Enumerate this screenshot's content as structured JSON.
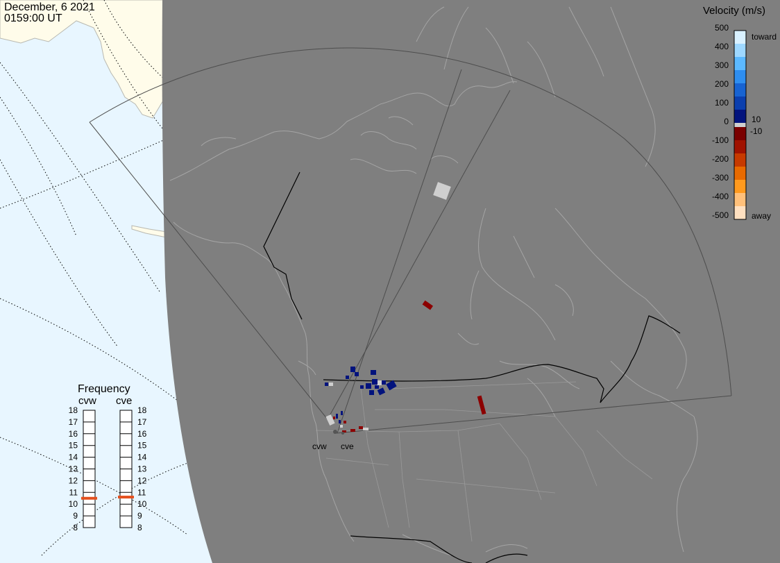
{
  "header": {
    "date": "December, 6 2021",
    "time": "0159:00 UT"
  },
  "colorbar": {
    "title": "Velocity (m/s)",
    "ticks": [
      "500",
      "400",
      "300",
      "200",
      "100",
      "0",
      "-100",
      "-200",
      "-300",
      "-400",
      "-500"
    ],
    "toward_label": "toward",
    "away_label": "away",
    "near_zero_pos": "10",
    "near_zero_neg": "-10",
    "colors_toward": [
      "#d9f1ff",
      "#9ed8ff",
      "#5cb9ff",
      "#2e8ef0",
      "#1763d2",
      "#0b3fae",
      "#02137d"
    ],
    "colors_away": [
      "#7a0000",
      "#a01200",
      "#c73a00",
      "#e86a00",
      "#ff9a1e",
      "#ffc07a",
      "#ffe0c0"
    ]
  },
  "frequency": {
    "title": "Frequency",
    "radars": [
      {
        "code": "cvw",
        "value_mhz": 10.5
      },
      {
        "code": "cve",
        "value_mhz": 10.6
      }
    ],
    "ticks": [
      "18",
      "17",
      "16",
      "15",
      "14",
      "13",
      "12",
      "11",
      "10",
      "9",
      "8"
    ],
    "marker_color": "#e4501e"
  },
  "map": {
    "sites": [
      {
        "code": "cvw"
      },
      {
        "code": "cve"
      }
    ],
    "colors": {
      "night": "#7f7f7f",
      "day_ocean": "#e8f6ff",
      "day_land": "#fffcea",
      "outline": "#a0a0a0",
      "fov": "#4d4d4d",
      "border": "#000000",
      "ground_scatter": "#cfcfcf"
    }
  }
}
